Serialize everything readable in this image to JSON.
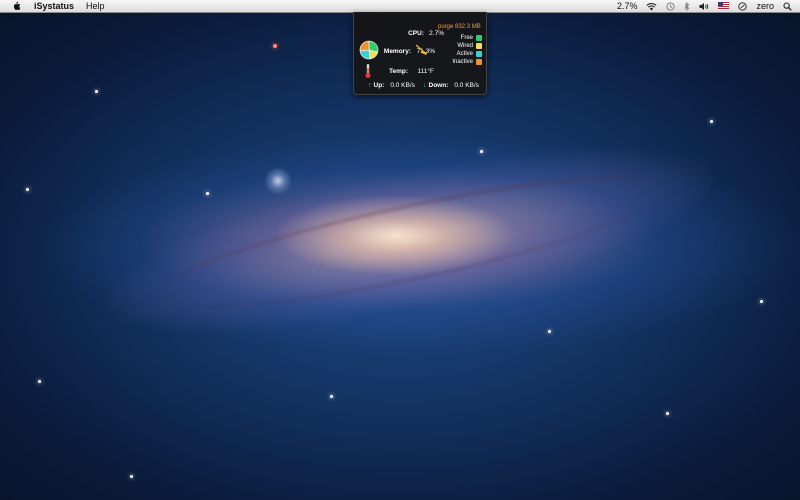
{
  "menubar": {
    "app_name": "iSystatus",
    "menus": [
      "Help"
    ],
    "cpu_percent": "2.7%",
    "user": "zero"
  },
  "panel": {
    "purge_text": "purge 832.3 MB",
    "cpu_label": "CPU:",
    "cpu_value": "2.7%",
    "memory_label": "Memory:",
    "memory_value": "71.3%",
    "temp_label": "Temp:",
    "temp_value": "111°F",
    "legend": [
      {
        "label": "Free",
        "color": "#2ecc71"
      },
      {
        "label": "Wired",
        "color": "#f1e05a"
      },
      {
        "label": "Active",
        "color": "#3ad0d8"
      },
      {
        "label": "Inactive",
        "color": "#f0932b"
      }
    ],
    "memory_pie": {
      "free": 28.7,
      "wired": 20,
      "active": 25,
      "inactive": 26.3
    },
    "up_label": "Up:",
    "up_value": "0.0 KB/s",
    "down_label": "Down:",
    "down_value": "0.0 KB/s"
  }
}
